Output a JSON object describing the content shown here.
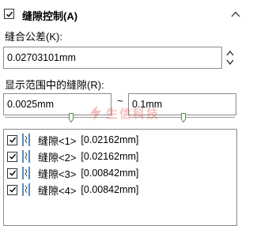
{
  "header": {
    "title": "缝隙控制(A)",
    "checked": true
  },
  "tolerance": {
    "label": "缝合公差(K):",
    "value": "0.02703101mm"
  },
  "range": {
    "label": "显示范围中的缝隙(R):",
    "min": "0.0025mm",
    "separator": "~",
    "max": "0.1mm",
    "min_level": 0.64,
    "max_level": 0.5
  },
  "gaps": [
    {
      "name": "缝隙<1>",
      "value": "[0.02162mm]",
      "checked": true
    },
    {
      "name": "缝隙<2>",
      "value": "[0.02162mm]",
      "checked": true
    },
    {
      "name": "缝隙<3>",
      "value": "[0.00842mm]",
      "checked": true
    },
    {
      "name": "缝隙<4>",
      "value": "[0.00842mm]",
      "checked": true
    }
  ],
  "watermark": {
    "text": "生信科技"
  },
  "icons": {
    "header_check": "check-icon",
    "collapse": "chevron-up-icon",
    "spinner": "spinner-arrows-icon",
    "gap": "gap-icon",
    "watermark": "lightning-logo-icon"
  },
  "colors": {
    "accent": "#e34a3f",
    "thumb": "#5a8a5a"
  }
}
